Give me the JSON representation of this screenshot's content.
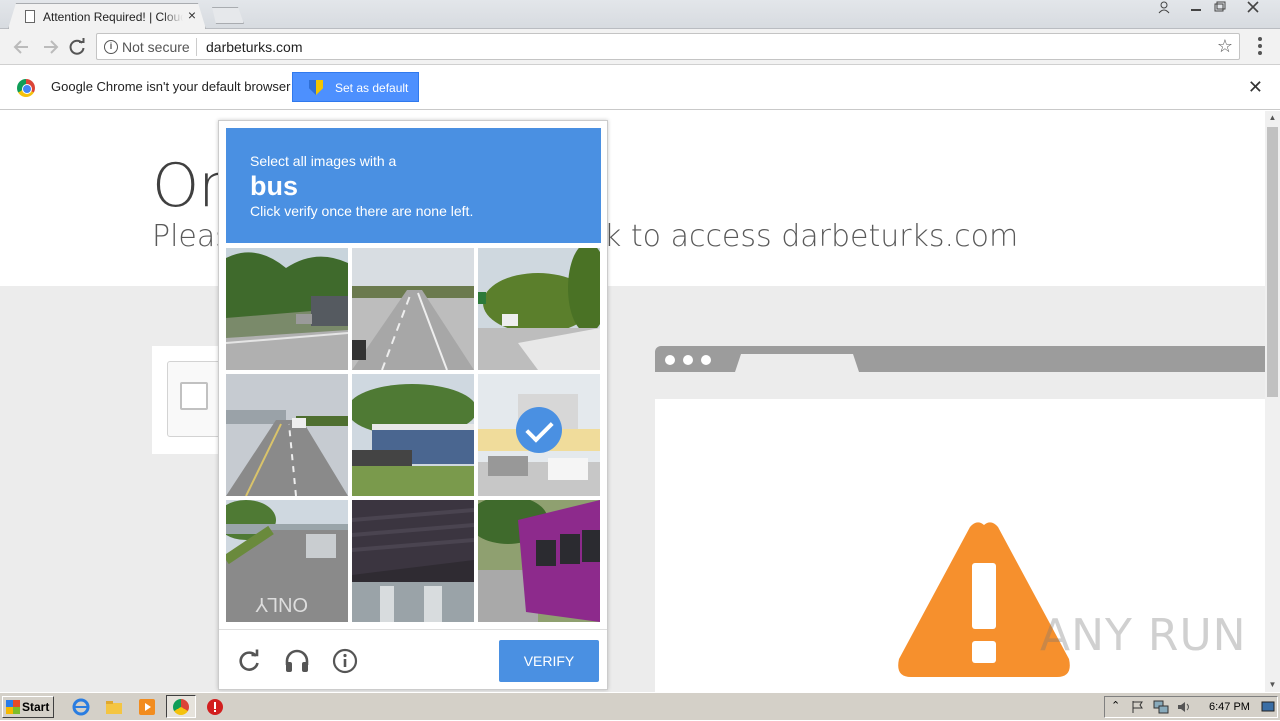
{
  "browser": {
    "tab_title": "Attention Required! | Cloudflare",
    "tab_close": "×",
    "security_label": "Not secure",
    "url": "darbeturks.com",
    "bookmark_star": "☆"
  },
  "infobar": {
    "message": "Google Chrome isn't your default browser",
    "button_label": "Set as default",
    "close": "✕"
  },
  "page": {
    "heading": "On",
    "subheading_left": "Pleas",
    "subheading_right": "k to access darbeturks.com"
  },
  "captcha": {
    "instruction_line1": "Select all images with a",
    "target_object": "bus",
    "instruction_line3": "Click verify once there are none left.",
    "verify_label": "VERIFY",
    "tiles": [
      {
        "scene": "street-trees-house",
        "selected": false
      },
      {
        "scene": "highway-lanes",
        "selected": false
      },
      {
        "scene": "road-trees-sign",
        "selected": false
      },
      {
        "scene": "road-car-trees",
        "selected": false
      },
      {
        "scene": "parked-cars-building",
        "selected": false
      },
      {
        "scene": "school-bus-street",
        "selected": true
      },
      {
        "scene": "road-only-marking",
        "selected": false
      },
      {
        "scene": "bridge-underside",
        "selected": false
      },
      {
        "scene": "purple-bus",
        "selected": false
      }
    ]
  },
  "watermark": "ANY RUN",
  "taskbar": {
    "start_label": "Start",
    "time": "6:47 PM"
  },
  "icons": {
    "back": "arrow-left-icon",
    "forward": "arrow-right-icon",
    "reload": "reload-icon",
    "info": "info-icon",
    "star": "star-icon",
    "menu": "menu-dots-icon",
    "refresh_captcha": "reload-icon",
    "audio": "headphones-icon",
    "help": "info-icon",
    "warning": "warning-icon"
  },
  "colors": {
    "captcha_blue": "#4a90e2",
    "set_default_blue": "#4d90fe",
    "warning_orange": "#f6902d"
  }
}
